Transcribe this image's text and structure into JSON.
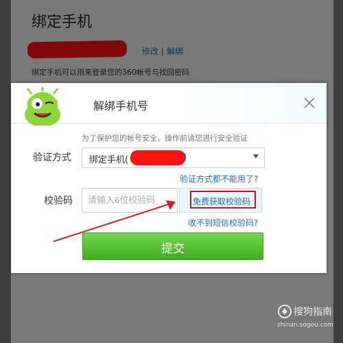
{
  "background": {
    "title": "绑定手机",
    "links": [
      "修改",
      "解绑"
    ],
    "description": "绑定手机可以用来登录您的360帐号与找回密码"
  },
  "modal": {
    "title": "解绑手机号",
    "security_hint": "为了保护您的帐号安全，操作前请您进行安全验证",
    "method_label": "验证方式",
    "method_selected": "绑定手机(",
    "method_suffix": ")",
    "method_unavailable_link": "验证方式都不能用了?",
    "code_label": "校验码",
    "code_placeholder": "请输入6位校验码",
    "get_code_button": "免费获取校验码",
    "no_sms_link": "收不到短信校验码?",
    "submit_button": "提交"
  },
  "watermark": {
    "brand": "搜狗指南",
    "site": "zhinan.sogou.com"
  },
  "colors": {
    "accent_green": "#44ac22",
    "link_blue": "#1f6fb2",
    "highlight_red": "#b71c1c",
    "redaction": "#ff1212"
  }
}
